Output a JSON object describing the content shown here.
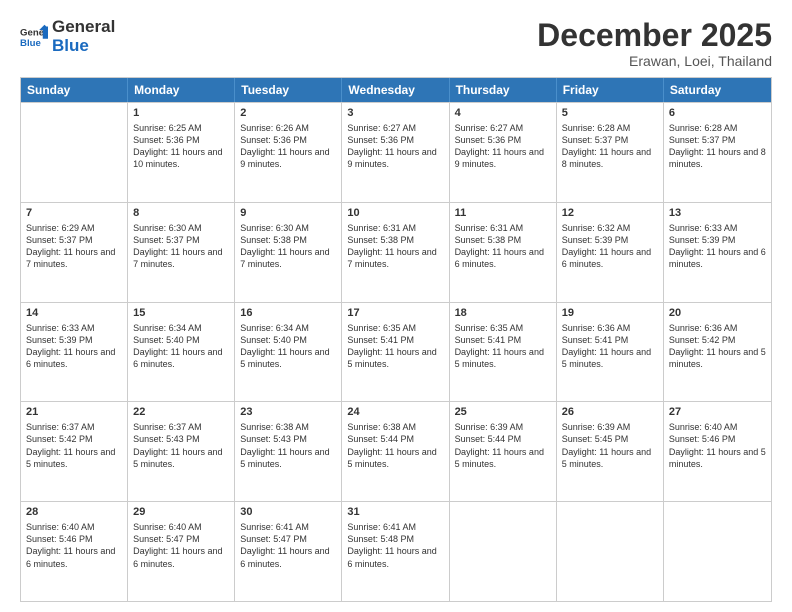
{
  "header": {
    "logo_general": "General",
    "logo_blue": "Blue",
    "month": "December 2025",
    "location": "Erawan, Loei, Thailand"
  },
  "days_of_week": [
    "Sunday",
    "Monday",
    "Tuesday",
    "Wednesday",
    "Thursday",
    "Friday",
    "Saturday"
  ],
  "weeks": [
    [
      {
        "day": "",
        "sunrise": "",
        "sunset": "",
        "daylight": ""
      },
      {
        "day": "1",
        "sunrise": "Sunrise: 6:25 AM",
        "sunset": "Sunset: 5:36 PM",
        "daylight": "Daylight: 11 hours and 10 minutes."
      },
      {
        "day": "2",
        "sunrise": "Sunrise: 6:26 AM",
        "sunset": "Sunset: 5:36 PM",
        "daylight": "Daylight: 11 hours and 9 minutes."
      },
      {
        "day": "3",
        "sunrise": "Sunrise: 6:27 AM",
        "sunset": "Sunset: 5:36 PM",
        "daylight": "Daylight: 11 hours and 9 minutes."
      },
      {
        "day": "4",
        "sunrise": "Sunrise: 6:27 AM",
        "sunset": "Sunset: 5:36 PM",
        "daylight": "Daylight: 11 hours and 9 minutes."
      },
      {
        "day": "5",
        "sunrise": "Sunrise: 6:28 AM",
        "sunset": "Sunset: 5:37 PM",
        "daylight": "Daylight: 11 hours and 8 minutes."
      },
      {
        "day": "6",
        "sunrise": "Sunrise: 6:28 AM",
        "sunset": "Sunset: 5:37 PM",
        "daylight": "Daylight: 11 hours and 8 minutes."
      }
    ],
    [
      {
        "day": "7",
        "sunrise": "Sunrise: 6:29 AM",
        "sunset": "Sunset: 5:37 PM",
        "daylight": "Daylight: 11 hours and 7 minutes."
      },
      {
        "day": "8",
        "sunrise": "Sunrise: 6:30 AM",
        "sunset": "Sunset: 5:37 PM",
        "daylight": "Daylight: 11 hours and 7 minutes."
      },
      {
        "day": "9",
        "sunrise": "Sunrise: 6:30 AM",
        "sunset": "Sunset: 5:38 PM",
        "daylight": "Daylight: 11 hours and 7 minutes."
      },
      {
        "day": "10",
        "sunrise": "Sunrise: 6:31 AM",
        "sunset": "Sunset: 5:38 PM",
        "daylight": "Daylight: 11 hours and 7 minutes."
      },
      {
        "day": "11",
        "sunrise": "Sunrise: 6:31 AM",
        "sunset": "Sunset: 5:38 PM",
        "daylight": "Daylight: 11 hours and 6 minutes."
      },
      {
        "day": "12",
        "sunrise": "Sunrise: 6:32 AM",
        "sunset": "Sunset: 5:39 PM",
        "daylight": "Daylight: 11 hours and 6 minutes."
      },
      {
        "day": "13",
        "sunrise": "Sunrise: 6:33 AM",
        "sunset": "Sunset: 5:39 PM",
        "daylight": "Daylight: 11 hours and 6 minutes."
      }
    ],
    [
      {
        "day": "14",
        "sunrise": "Sunrise: 6:33 AM",
        "sunset": "Sunset: 5:39 PM",
        "daylight": "Daylight: 11 hours and 6 minutes."
      },
      {
        "day": "15",
        "sunrise": "Sunrise: 6:34 AM",
        "sunset": "Sunset: 5:40 PM",
        "daylight": "Daylight: 11 hours and 6 minutes."
      },
      {
        "day": "16",
        "sunrise": "Sunrise: 6:34 AM",
        "sunset": "Sunset: 5:40 PM",
        "daylight": "Daylight: 11 hours and 5 minutes."
      },
      {
        "day": "17",
        "sunrise": "Sunrise: 6:35 AM",
        "sunset": "Sunset: 5:41 PM",
        "daylight": "Daylight: 11 hours and 5 minutes."
      },
      {
        "day": "18",
        "sunrise": "Sunrise: 6:35 AM",
        "sunset": "Sunset: 5:41 PM",
        "daylight": "Daylight: 11 hours and 5 minutes."
      },
      {
        "day": "19",
        "sunrise": "Sunrise: 6:36 AM",
        "sunset": "Sunset: 5:41 PM",
        "daylight": "Daylight: 11 hours and 5 minutes."
      },
      {
        "day": "20",
        "sunrise": "Sunrise: 6:36 AM",
        "sunset": "Sunset: 5:42 PM",
        "daylight": "Daylight: 11 hours and 5 minutes."
      }
    ],
    [
      {
        "day": "21",
        "sunrise": "Sunrise: 6:37 AM",
        "sunset": "Sunset: 5:42 PM",
        "daylight": "Daylight: 11 hours and 5 minutes."
      },
      {
        "day": "22",
        "sunrise": "Sunrise: 6:37 AM",
        "sunset": "Sunset: 5:43 PM",
        "daylight": "Daylight: 11 hours and 5 minutes."
      },
      {
        "day": "23",
        "sunrise": "Sunrise: 6:38 AM",
        "sunset": "Sunset: 5:43 PM",
        "daylight": "Daylight: 11 hours and 5 minutes."
      },
      {
        "day": "24",
        "sunrise": "Sunrise: 6:38 AM",
        "sunset": "Sunset: 5:44 PM",
        "daylight": "Daylight: 11 hours and 5 minutes."
      },
      {
        "day": "25",
        "sunrise": "Sunrise: 6:39 AM",
        "sunset": "Sunset: 5:44 PM",
        "daylight": "Daylight: 11 hours and 5 minutes."
      },
      {
        "day": "26",
        "sunrise": "Sunrise: 6:39 AM",
        "sunset": "Sunset: 5:45 PM",
        "daylight": "Daylight: 11 hours and 5 minutes."
      },
      {
        "day": "27",
        "sunrise": "Sunrise: 6:40 AM",
        "sunset": "Sunset: 5:46 PM",
        "daylight": "Daylight: 11 hours and 5 minutes."
      }
    ],
    [
      {
        "day": "28",
        "sunrise": "Sunrise: 6:40 AM",
        "sunset": "Sunset: 5:46 PM",
        "daylight": "Daylight: 11 hours and 6 minutes."
      },
      {
        "day": "29",
        "sunrise": "Sunrise: 6:40 AM",
        "sunset": "Sunset: 5:47 PM",
        "daylight": "Daylight: 11 hours and 6 minutes."
      },
      {
        "day": "30",
        "sunrise": "Sunrise: 6:41 AM",
        "sunset": "Sunset: 5:47 PM",
        "daylight": "Daylight: 11 hours and 6 minutes."
      },
      {
        "day": "31",
        "sunrise": "Sunrise: 6:41 AM",
        "sunset": "Sunset: 5:48 PM",
        "daylight": "Daylight: 11 hours and 6 minutes."
      },
      {
        "day": "",
        "sunrise": "",
        "sunset": "",
        "daylight": ""
      },
      {
        "day": "",
        "sunrise": "",
        "sunset": "",
        "daylight": ""
      },
      {
        "day": "",
        "sunrise": "",
        "sunset": "",
        "daylight": ""
      }
    ]
  ]
}
